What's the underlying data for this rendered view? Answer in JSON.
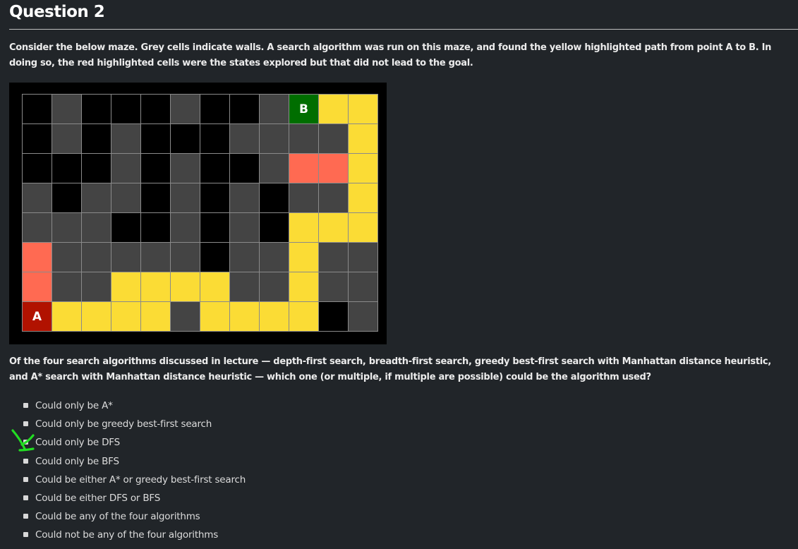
{
  "question": {
    "title": "Question 2",
    "prompt": "Consider the below maze. Grey cells indicate walls. A search algorithm was run on this maze, and found the yellow highlighted path from point A to B. In doing so, the red highlighted cells were the states explored but that did not lead to the goal.",
    "followup": "Of the four search algorithms discussed in lecture — depth-first search, breadth-first search, greedy best-first search with Manhattan distance heuristic, and A* search with Manhattan distance heuristic — which one (or multiple, if multiple are possible) could be the algorithm used?"
  },
  "maze": {
    "legend": {
      "O": "open",
      "W": "wall",
      "P": "path",
      "E": "explored",
      "G": "goal",
      "S": "start"
    },
    "colors": {
      "open": "#000000",
      "wall": "#444444",
      "path": "#fbdc35",
      "explored": "#ff6a52",
      "goal": "#006e00",
      "start": "#b11200"
    },
    "goal_label": "B",
    "start_label": "A",
    "rows": [
      "OWOOOWOOWGPP",
      "OWOWOOOWWWWP",
      "OOOWOWOOWEEP",
      "WOWWOWOWOWWP",
      "WWWOOWOWOPPP",
      "EWWWWWOWWPWW",
      "EWWPPPPWWPWW",
      "SPPPPWPPPPOW"
    ]
  },
  "options": [
    {
      "label": "Could only be A*"
    },
    {
      "label": "Could only be greedy best-first search"
    },
    {
      "label": "Could only be DFS",
      "marked": true
    },
    {
      "label": "Could only be BFS"
    },
    {
      "label": "Could be either A* or greedy best-first search"
    },
    {
      "label": "Could be either DFS or BFS"
    },
    {
      "label": "Could be any of the four algorithms"
    },
    {
      "label": "Could not be any of the four algorithms"
    }
  ],
  "annotation": {
    "color": "#22dd22",
    "icon": "handwritten-x-mark"
  }
}
